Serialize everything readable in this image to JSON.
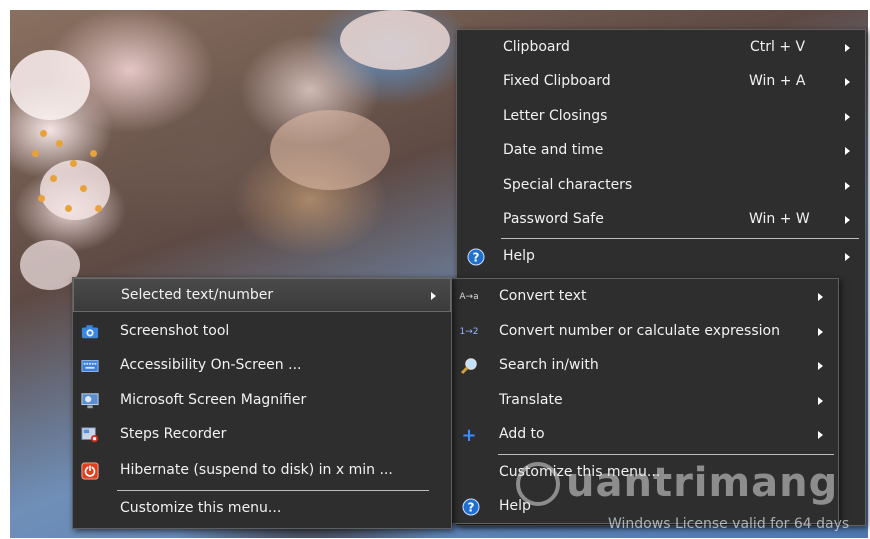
{
  "main_menu": {
    "items": [
      {
        "label": "Clipboard",
        "shortcut": "Ctrl + V",
        "arrow": true
      },
      {
        "label": "Fixed Clipboard",
        "shortcut": "Win + A",
        "arrow": true
      },
      {
        "label": "Letter Closings",
        "shortcut": "",
        "arrow": true
      },
      {
        "label": "Date and time",
        "shortcut": "",
        "arrow": true
      },
      {
        "label": "Special characters",
        "shortcut": "",
        "arrow": true
      },
      {
        "label": "Password Safe",
        "shortcut": "Win + W",
        "arrow": true
      },
      {
        "label": "Help",
        "shortcut": "",
        "arrow": true,
        "icon": "help-icon"
      }
    ]
  },
  "left_menu": {
    "items": [
      {
        "label": "Selected text/number",
        "icon": "",
        "arrow": true,
        "highlighted": true
      },
      {
        "label": "Screenshot tool",
        "icon": "camera-icon"
      },
      {
        "label": "Accessibility On-Screen ...",
        "icon": "keyboard-icon"
      },
      {
        "label": "Microsoft Screen Magnifier",
        "icon": "magnifier-monitor-icon"
      },
      {
        "label": "Steps Recorder",
        "icon": "steps-recorder-icon"
      },
      {
        "label": "Hibernate (suspend to disk) in x min ...",
        "icon": "power-icon"
      },
      {
        "label": "Customize this menu...",
        "icon": ""
      }
    ]
  },
  "sub_menu": {
    "items": [
      {
        "label": "Convert text",
        "icon": "convert-text-icon",
        "arrow": true
      },
      {
        "label": "Convert number or calculate expression",
        "icon": "convert-number-icon",
        "arrow": true
      },
      {
        "label": "Search in/with",
        "icon": "search-icon",
        "arrow": true
      },
      {
        "label": "Translate",
        "icon": "",
        "arrow": true
      },
      {
        "label": "Add to",
        "icon": "plus-icon",
        "arrow": true
      },
      {
        "label": "Customize this menu...",
        "icon": ""
      },
      {
        "label": "Help",
        "icon": "help-icon"
      }
    ]
  },
  "watermark": "uantrimang",
  "license_text": "Windows License valid for 64 days",
  "icon_glyphs": {
    "convert_text": "A→a",
    "convert_number": "1→2"
  },
  "colors": {
    "menu_bg": "#2e2e2e",
    "menu_text": "#f2f2f2",
    "help_blue": "#1f6fd0",
    "power_red": "#e04020"
  }
}
